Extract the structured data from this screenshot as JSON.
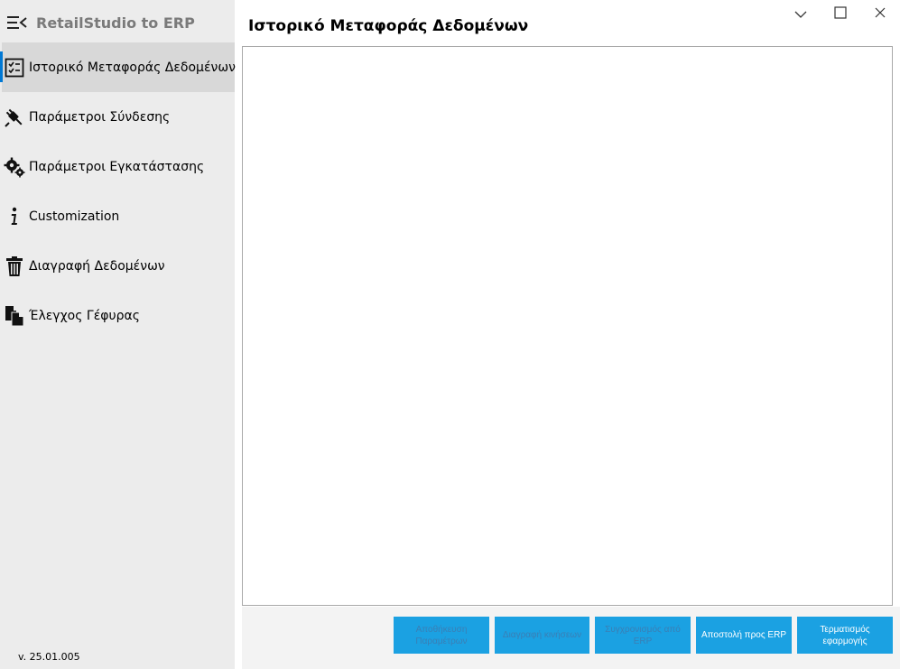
{
  "app": {
    "title": "RetailStudio to ERP",
    "version": "v. 25.01.005"
  },
  "page": {
    "title": "Ιστορικό Μεταφοράς Δεδομένων"
  },
  "sidebar": {
    "items": [
      {
        "label": "Ιστορικό Μεταφοράς Δεδομένων",
        "icon": "checklist-icon",
        "active": true
      },
      {
        "label": "Παράμετροι Σύνδεσης",
        "icon": "plug-icon",
        "active": false
      },
      {
        "label": "Παράμετροι Εγκατάστασης",
        "icon": "gears-icon",
        "active": false
      },
      {
        "label": "Customization",
        "icon": "info-icon",
        "active": false
      },
      {
        "label": "Διαγραφή Δεδομένων",
        "icon": "trash-icon",
        "active": false
      },
      {
        "label": "Έλεγχος Γέφυρας",
        "icon": "documents-icon",
        "active": false
      }
    ]
  },
  "footer": {
    "buttons": [
      {
        "label": "Αποθήκευση Παραμέτρων",
        "enabled": false
      },
      {
        "label": "Διαγραφή κινήσεων",
        "enabled": false
      },
      {
        "label": "Συγχρονισμός από ERP",
        "enabled": false
      },
      {
        "label": "Αποστολή προς ERP",
        "enabled": true
      },
      {
        "label": "Τερματισμός εφαρμογής",
        "enabled": true
      }
    ]
  },
  "colors": {
    "sidebar_bg": "#ececec",
    "active_item_bg": "#d8d8d8",
    "accent": "#0078d4",
    "button_bg": "#1ba1e2"
  }
}
